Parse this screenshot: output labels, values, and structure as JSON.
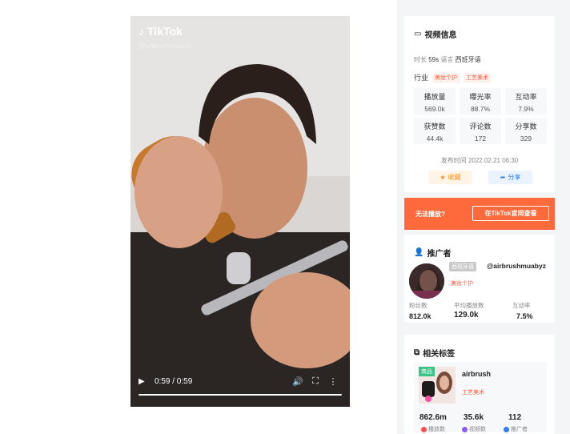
{
  "video": {
    "brand": "TikTok",
    "handle": "@airbrushmuabyz",
    "time": "0:59 / 0:59"
  },
  "info": {
    "title": "视频信息",
    "duration_label": "时长",
    "duration": "59s",
    "language_label": "语言",
    "language": "西班牙语",
    "industry_label": "行业",
    "industry_tags": [
      "美妆个护",
      "工艺美术"
    ],
    "stats": [
      {
        "label": "播放量",
        "value": "569.0k"
      },
      {
        "label": "曝光率",
        "value": "88.7%"
      },
      {
        "label": "互动率",
        "value": "7.9%"
      },
      {
        "label": "获赞数",
        "value": "44.4k"
      },
      {
        "label": "评论数",
        "value": "172"
      },
      {
        "label": "分享数",
        "value": "329"
      }
    ],
    "publish_time": "发布时间 2022.02.21 06:30",
    "favorite": "收藏",
    "share": "分享"
  },
  "alert": {
    "message": "无法播放?",
    "action": "在TikTok官网查看"
  },
  "promoter": {
    "title": "推广者",
    "country": "西班牙语",
    "username": "@airbrushmuabyz",
    "category": "美妆个护",
    "stats": [
      {
        "label": "粉丝数",
        "value": "812.0k"
      },
      {
        "label": "平均播放数",
        "value": "129.0k"
      },
      {
        "label": "互动率",
        "value": "7.5%"
      }
    ]
  },
  "tags": {
    "title": "相关标签",
    "badge": "商品",
    "name": "airbrush",
    "category": "工艺美术",
    "stats": [
      {
        "label": "播放数",
        "value": "862.6m",
        "color": "#ff4d4f"
      },
      {
        "label": "视频数",
        "value": "35.6k",
        "color": "#8a5cf6"
      },
      {
        "label": "推广者",
        "value": "112",
        "color": "#2e7cf6"
      }
    ]
  },
  "colors": {
    "accent": "#ff6a3d",
    "tag_text": "#ff5a3c",
    "share_blue": "#2e7cf6"
  }
}
